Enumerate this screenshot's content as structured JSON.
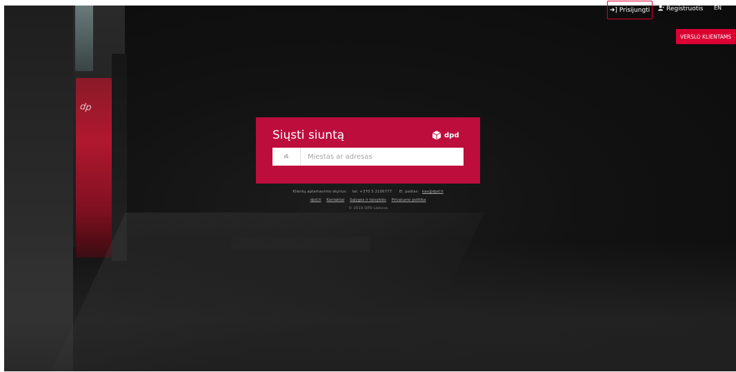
{
  "nav": {
    "login_label": "Prisijungti",
    "login_icon": "sign-in-icon",
    "register_label": "Registruotis",
    "register_icon": "user-icon",
    "lang_label": "EN"
  },
  "business_button": {
    "label": "VERSLO KLIENTAMS"
  },
  "card": {
    "title": "Siųsti siuntą",
    "logo_text": "dpd",
    "logo_icon": "dpd-cube-icon",
    "from_label": "IŠ",
    "address_placeholder": "Miestas ar adresas"
  },
  "footer": {
    "support_label": "Klientų aptarnavimo skyrius:",
    "phone": "tel. +370 5 2106777",
    "email_label": "El. paštas:",
    "email": "kas@dpd.lt",
    "links": [
      "dpd.lt",
      "Kontaktai",
      "Sąlygos ir taisyklės",
      "Privatumo politika"
    ],
    "copyright": "© 2019 DPD Lietuva"
  },
  "colors": {
    "brand_red": "#dc0032",
    "card_red": "#bd0d3d"
  }
}
